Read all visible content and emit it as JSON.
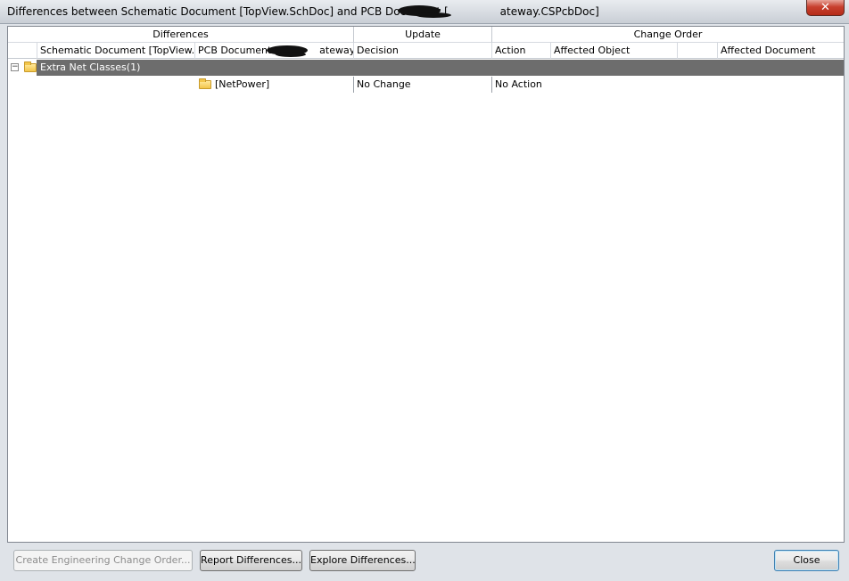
{
  "window": {
    "title_prefix": "Differences between Schematic Document [TopView.SchDoc] and PCB Document [",
    "title_suffix": "ateway.CSPcbDoc]",
    "close_glyph": "✕"
  },
  "grid": {
    "groups": [
      "Differences",
      "Update",
      "Change Order"
    ],
    "columns": [
      "Schematic Document [TopView....",
      "PCB Document [",
      "ateway.C...",
      "Decision",
      "Action",
      "Affected Object",
      "",
      "Affected Document"
    ],
    "group_row": {
      "expander": "−",
      "label": "Extra Net Classes(1)"
    },
    "rows": [
      {
        "pcb_item": "[NetPower]",
        "decision": "No Change",
        "action": "No Action"
      }
    ]
  },
  "buttons": {
    "create_eco": "Create Engineering Change Order...",
    "report_differences": "Report Differences...",
    "explore_differences": "Explore Differences...",
    "close": "Close"
  }
}
